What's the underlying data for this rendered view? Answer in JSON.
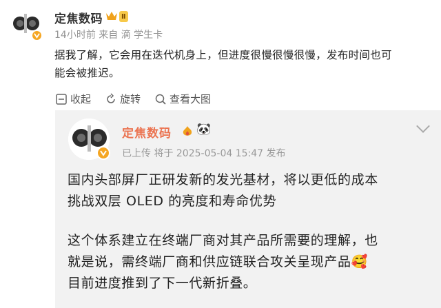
{
  "post": {
    "username": "定焦数码",
    "level_badge": "Ⅱ",
    "time": "14小时前",
    "source": "来自 滴 学生卡",
    "text_line1": "据我了解，它会用在迭代机身上，但进度很慢很慢很慢，发布时间也可",
    "text_line2": "能会被推迟。"
  },
  "actions": {
    "collapse": "收起",
    "rotate": "旋转",
    "view_large": "查看大图"
  },
  "retweet": {
    "username": "定焦数码",
    "emoji_panda": "🐼",
    "meta": "已上传 将于 2025-05-04 15:47 发布",
    "para1_line1": "国内头部屏厂正研发新的发光基材，将以更低的成本",
    "para1_line2": "挑战双层 OLED 的亮度和寿命优势",
    "para2_line1": "这个体系建立在终端厂商对其产品所需要的理解，也",
    "para2_line2": "就是说，需终端厂商和供应链联合攻关呈现产品",
    "para2_emoji": "🥰",
    "para2_line3": "目前进度推到了下一代新折叠。"
  },
  "colors": {
    "accent": "#eb7350",
    "meta": "#939393",
    "card_bg": "#f2f2f2",
    "verified": "#f5a623"
  }
}
